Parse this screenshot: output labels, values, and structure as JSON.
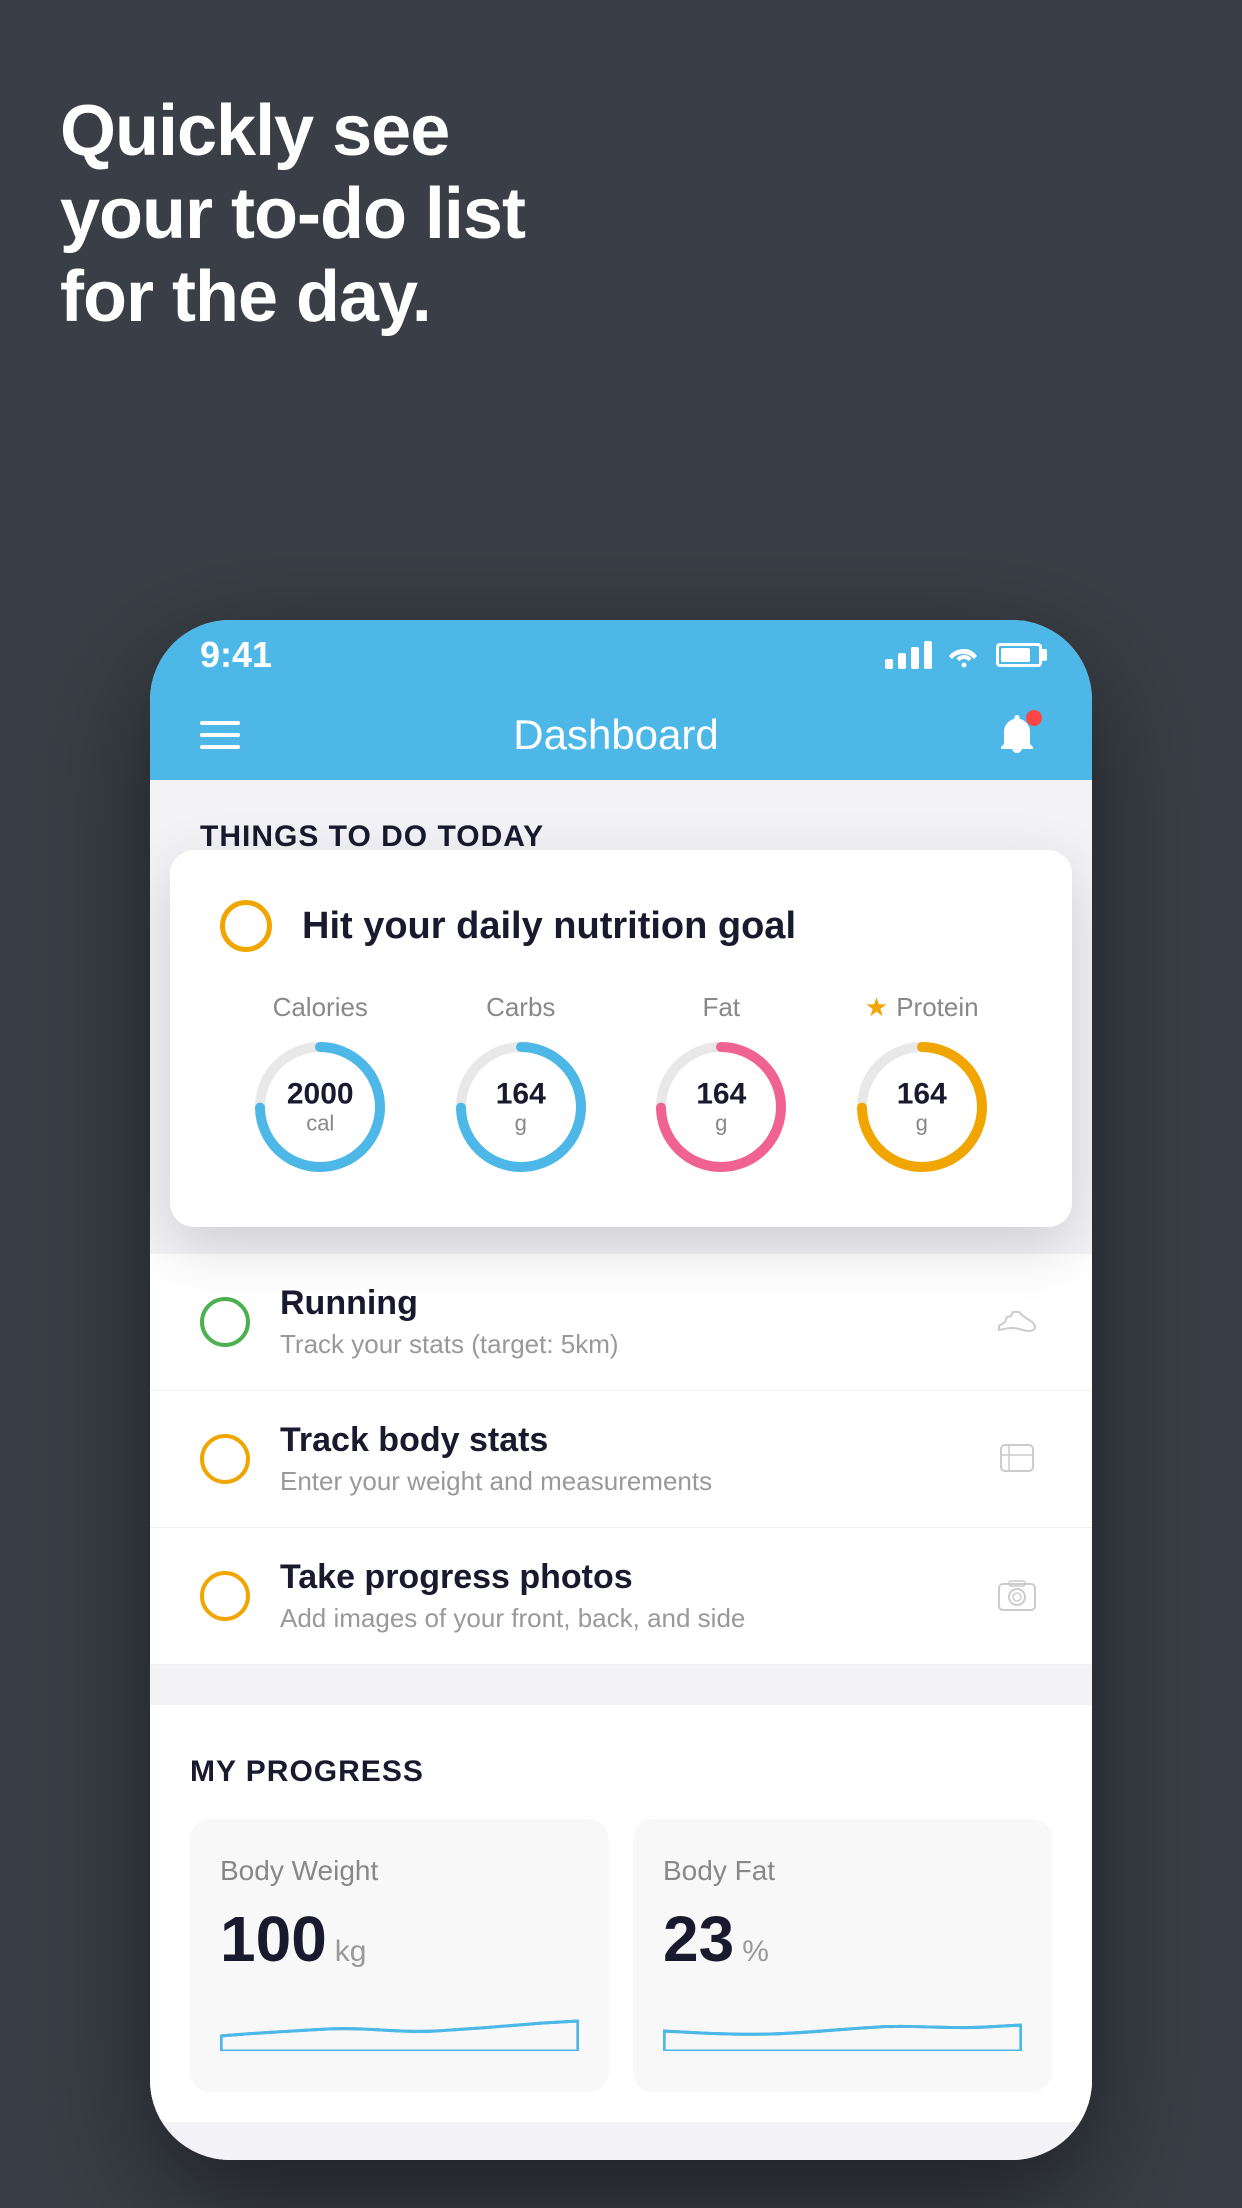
{
  "background": {
    "color": "#3a3f47"
  },
  "headline": {
    "line1": "Quickly see",
    "line2": "your to-do list",
    "line3": "for the day."
  },
  "statusBar": {
    "time": "9:41",
    "signal": "signal",
    "wifi": "wifi",
    "battery": "battery"
  },
  "navBar": {
    "title": "Dashboard",
    "menuIcon": "hamburger-icon",
    "bellIcon": "bell-icon"
  },
  "thingsToDo": {
    "sectionTitle": "THINGS TO DO TODAY"
  },
  "floatingCard": {
    "title": "Hit your daily nutrition goal",
    "nutrition": {
      "calories": {
        "label": "Calories",
        "value": "2000",
        "unit": "cal",
        "color": "blue"
      },
      "carbs": {
        "label": "Carbs",
        "value": "164",
        "unit": "g",
        "color": "blue"
      },
      "fat": {
        "label": "Fat",
        "value": "164",
        "unit": "g",
        "color": "pink"
      },
      "protein": {
        "label": "Protein",
        "value": "164",
        "unit": "g",
        "color": "gold",
        "starred": true
      }
    }
  },
  "listItems": [
    {
      "title": "Running",
      "subtitle": "Track your stats (target: 5km)",
      "circleColor": "green",
      "icon": "shoe-icon"
    },
    {
      "title": "Track body stats",
      "subtitle": "Enter your weight and measurements",
      "circleColor": "yellow",
      "icon": "scale-icon"
    },
    {
      "title": "Take progress photos",
      "subtitle": "Add images of your front, back, and side",
      "circleColor": "yellow",
      "icon": "photo-icon"
    }
  ],
  "progressSection": {
    "title": "MY PROGRESS",
    "cards": [
      {
        "title": "Body Weight",
        "value": "100",
        "unit": "kg"
      },
      {
        "title": "Body Fat",
        "value": "23",
        "unit": "%"
      }
    ]
  }
}
